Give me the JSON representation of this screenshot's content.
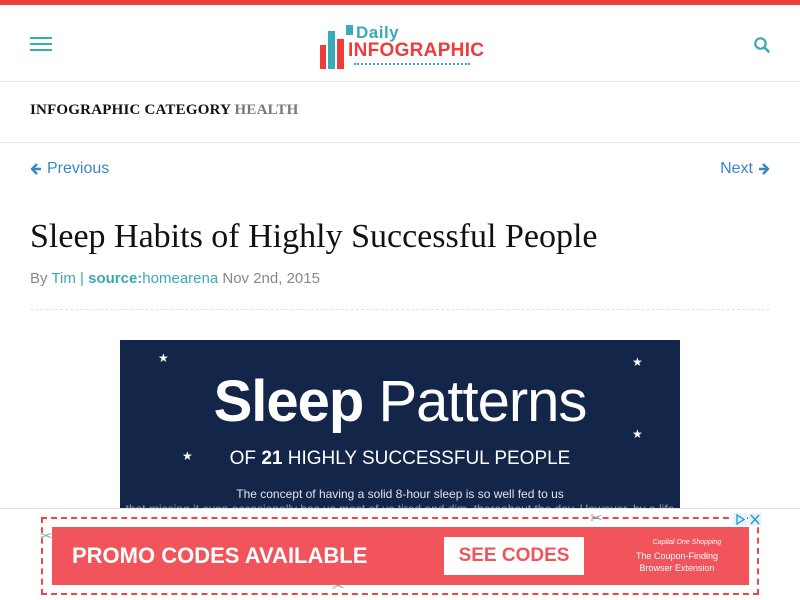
{
  "colors": {
    "accent_red": "#ee3b3b",
    "accent_teal": "#3aa9b8",
    "link_blue": "#3d86c6",
    "infographic_bg": "#14254a",
    "ad_red": "#f2545b"
  },
  "header": {
    "menu_icon": "hamburger-menu-icon",
    "search_icon": "search-icon",
    "logo": {
      "top_text": "Daily",
      "main_text": "INFOGRAPHIC"
    }
  },
  "category": {
    "prefix": "INFOGRAPHIC CATEGORY",
    "value": "HEALTH"
  },
  "nav": {
    "previous": "Previous",
    "next": "Next"
  },
  "article": {
    "title": "Sleep Habits of Highly Successful People",
    "by": "By",
    "author": "Tim",
    "separator": "|",
    "source_label": "source:",
    "source_value": "homearena",
    "date": "Nov 2nd, 2015"
  },
  "infographic": {
    "title_bold": "Sleep",
    "title_light": "Patterns",
    "sub_prefix": "OF",
    "sub_number": "21",
    "sub_suffix": "HIGHLY SUCCESSFUL PEOPLE",
    "body_line1": "The concept of having a solid 8-hour sleep is so well fed to us",
    "body_line2": "that missing it even occasionally has us most of us tired and dim, thereabout the day. However, by a life"
  },
  "ad": {
    "headline": "PROMO CODES AVAILABLE",
    "button": "SEE CODES",
    "brand": "Capital One Shopping",
    "tagline_1": "The Coupon-Finding",
    "tagline_2": "Browser Extension"
  }
}
